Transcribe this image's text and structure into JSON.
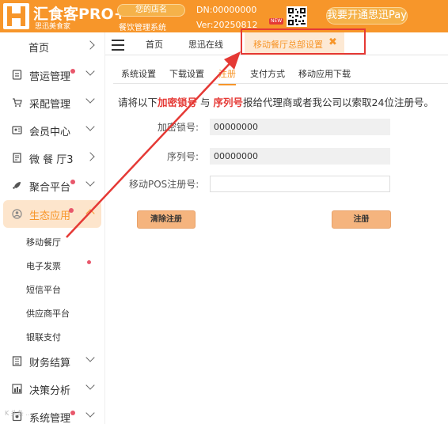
{
  "header": {
    "brand": "汇食客PRO+",
    "brand_sub": "思迅美食家",
    "store_name": "您的店名",
    "store_sub": "餐饮管理系统",
    "dn": "DN:00000000",
    "ver": "Ver:20250812",
    "new_tag": "NEW",
    "pay_button": "我要开通思迅Pay",
    "accent_color": "#f7962a"
  },
  "sidebar": {
    "items": [
      {
        "label": "首页",
        "icon": "none",
        "dot": false,
        "chevron": "right"
      },
      {
        "label": "营运管理",
        "icon": "clipboard-icon",
        "dot": true,
        "chevron": "down"
      },
      {
        "label": "采配管理",
        "icon": "cart-icon",
        "dot": false,
        "chevron": "down"
      },
      {
        "label": "会员中心",
        "icon": "member-icon",
        "dot": false,
        "chevron": "down"
      },
      {
        "label": "微 餐 厅3",
        "icon": "receipt-icon",
        "dot": false,
        "chevron": "right"
      },
      {
        "label": "聚合平台",
        "icon": "rocket-icon",
        "dot": true,
        "chevron": "down"
      },
      {
        "label": "生态应用",
        "icon": "person-icon",
        "dot": true,
        "chevron": "up",
        "active": true
      },
      {
        "label": "财务结算",
        "icon": "finance-icon",
        "dot": false,
        "chevron": "down"
      },
      {
        "label": "决策分析",
        "icon": "chart-icon",
        "dot": false,
        "chevron": "down"
      },
      {
        "label": "系统管理",
        "icon": "settings-icon",
        "dot": true,
        "chevron": "down"
      }
    ],
    "sub_items": [
      {
        "label": "移动餐厅",
        "dot": false
      },
      {
        "label": "电子发票",
        "dot": true
      },
      {
        "label": "短信平台",
        "dot": false
      },
      {
        "label": "供应商平台",
        "dot": false
      },
      {
        "label": "银联支付",
        "dot": false
      }
    ]
  },
  "tabs": {
    "home": "首页",
    "online": "思迅在线",
    "active": "移动餐厅总部设置",
    "close_glyph": "✖"
  },
  "subtabs": {
    "items": [
      "系统设置",
      "下载设置",
      "注册",
      "支付方式",
      "移动应用下载"
    ],
    "active_index": 2
  },
  "notice": {
    "p1": "请将以下",
    "r1": "加密锁号",
    "p2": "与",
    "r2": "序列号",
    "p3": "报给代理商或者我公司以索取24位注册号。"
  },
  "form": {
    "lock_label": "加密锁号:",
    "lock_value": "00000000",
    "serial_label": "序列号:",
    "serial_value": "00000000",
    "pos_label": "移动POS注册号:",
    "pos_value": ""
  },
  "buttons": {
    "clear": "清除注册",
    "register": "注册"
  },
  "watermark": "K 头条 …"
}
